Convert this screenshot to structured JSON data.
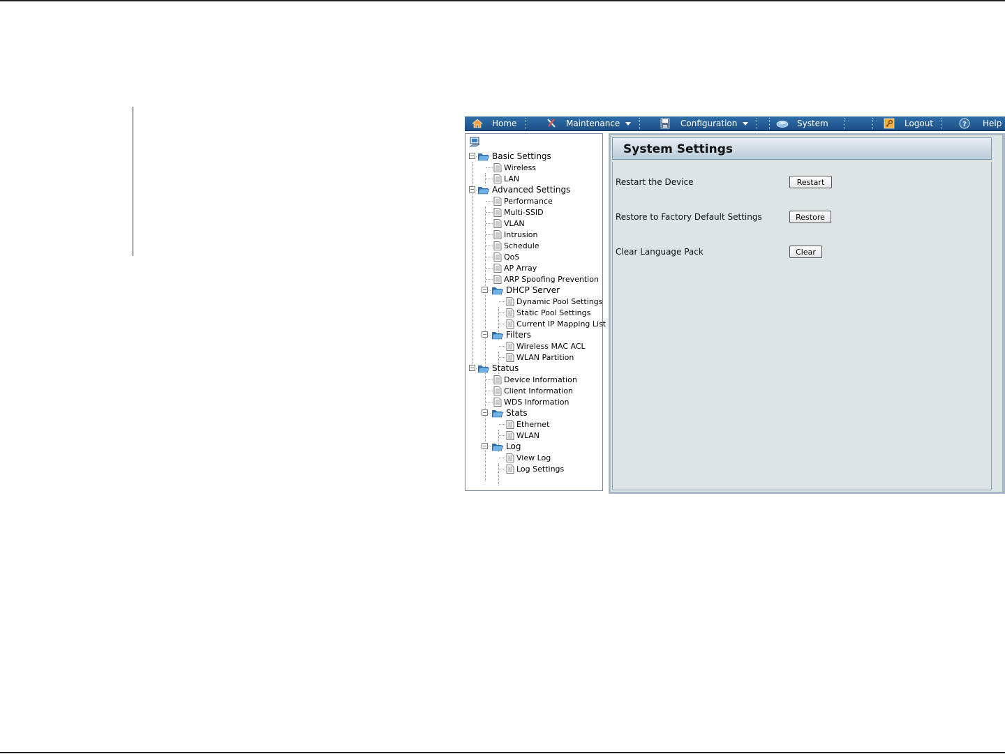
{
  "nav": {
    "home": "Home",
    "maintenance": "Maintenance",
    "configuration": "Configuration",
    "system": "System",
    "logout": "Logout",
    "help": "Help"
  },
  "tree": {
    "basic": "Basic Settings",
    "wireless": "Wireless",
    "lan": "LAN",
    "advanced": "Advanced Settings",
    "performance": "Performance",
    "multi_ssid": "Multi-SSID",
    "vlan": "VLAN",
    "intrusion": "Intrusion",
    "schedule": "Schedule",
    "qos": "QoS",
    "ap_array": "AP Array",
    "arp": "ARP Spoofing Prevention",
    "dhcp": "DHCP Server",
    "dynamic_pool": "Dynamic Pool Settings",
    "static_pool": "Static Pool Settings",
    "current_ip": "Current IP Mapping List",
    "filters": "Filters",
    "wireless_mac_acl": "Wireless MAC ACL",
    "wlan_partition": "WLAN Partition",
    "status": "Status",
    "device_info": "Device Information",
    "client_info": "Client Information",
    "wds_info": "WDS Information",
    "stats": "Stats",
    "ethernet": "Ethernet",
    "wlan": "WLAN",
    "log": "Log",
    "view_log": "View Log",
    "log_settings": "Log Settings"
  },
  "content": {
    "title": "System Settings",
    "restart_label": "Restart the Device",
    "restart_button": "Restart",
    "restore_label": "Restore to Factory Default Settings",
    "restore_button": "Restore",
    "clear_label": "Clear Language Pack",
    "clear_button": "Clear"
  },
  "colors": {
    "navbar": "#1d4f86",
    "content_bg": "#dce4e4",
    "folder": "#4a90c8"
  }
}
